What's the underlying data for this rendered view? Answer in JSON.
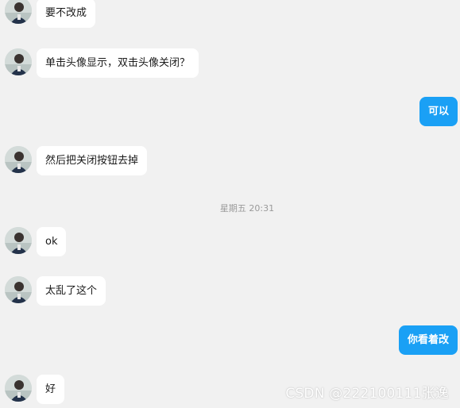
{
  "messages": [
    {
      "side": "in",
      "text": "要不改成"
    },
    {
      "side": "in",
      "text": "单击头像显示，双击头像关闭？"
    },
    {
      "side": "out",
      "text": "可以"
    },
    {
      "side": "in",
      "text": "然后把关闭按钮去掉"
    },
    {
      "side": "in",
      "text": "ok"
    },
    {
      "side": "in",
      "text": "太乱了这个"
    },
    {
      "side": "out",
      "text": "你看着改"
    },
    {
      "side": "in",
      "text": "好"
    }
  ],
  "timestamp": "星期五 20:31",
  "watermark": "CSDN @222100111张逸",
  "colors": {
    "background": "#f1f1f1",
    "incoming_bubble": "#ffffff",
    "outgoing_bubble": "#1aa0f5"
  }
}
